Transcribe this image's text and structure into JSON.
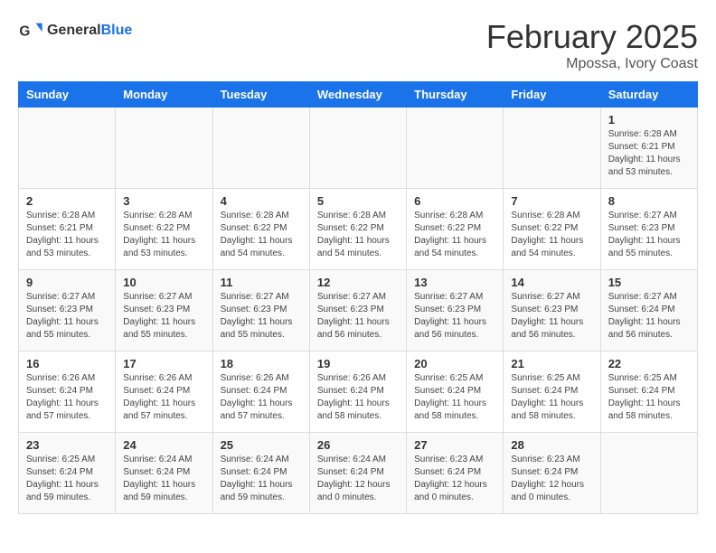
{
  "header": {
    "logo_text_general": "General",
    "logo_text_blue": "Blue",
    "main_title": "February 2025",
    "subtitle": "Mpossa, Ivory Coast"
  },
  "calendar": {
    "days_of_week": [
      "Sunday",
      "Monday",
      "Tuesday",
      "Wednesday",
      "Thursday",
      "Friday",
      "Saturday"
    ],
    "weeks": [
      [
        {
          "day": "",
          "info": ""
        },
        {
          "day": "",
          "info": ""
        },
        {
          "day": "",
          "info": ""
        },
        {
          "day": "",
          "info": ""
        },
        {
          "day": "",
          "info": ""
        },
        {
          "day": "",
          "info": ""
        },
        {
          "day": "1",
          "info": "Sunrise: 6:28 AM\nSunset: 6:21 PM\nDaylight: 11 hours\nand 53 minutes."
        }
      ],
      [
        {
          "day": "2",
          "info": "Sunrise: 6:28 AM\nSunset: 6:21 PM\nDaylight: 11 hours\nand 53 minutes."
        },
        {
          "day": "3",
          "info": "Sunrise: 6:28 AM\nSunset: 6:22 PM\nDaylight: 11 hours\nand 53 minutes."
        },
        {
          "day": "4",
          "info": "Sunrise: 6:28 AM\nSunset: 6:22 PM\nDaylight: 11 hours\nand 54 minutes."
        },
        {
          "day": "5",
          "info": "Sunrise: 6:28 AM\nSunset: 6:22 PM\nDaylight: 11 hours\nand 54 minutes."
        },
        {
          "day": "6",
          "info": "Sunrise: 6:28 AM\nSunset: 6:22 PM\nDaylight: 11 hours\nand 54 minutes."
        },
        {
          "day": "7",
          "info": "Sunrise: 6:28 AM\nSunset: 6:22 PM\nDaylight: 11 hours\nand 54 minutes."
        },
        {
          "day": "8",
          "info": "Sunrise: 6:27 AM\nSunset: 6:23 PM\nDaylight: 11 hours\nand 55 minutes."
        }
      ],
      [
        {
          "day": "9",
          "info": "Sunrise: 6:27 AM\nSunset: 6:23 PM\nDaylight: 11 hours\nand 55 minutes."
        },
        {
          "day": "10",
          "info": "Sunrise: 6:27 AM\nSunset: 6:23 PM\nDaylight: 11 hours\nand 55 minutes."
        },
        {
          "day": "11",
          "info": "Sunrise: 6:27 AM\nSunset: 6:23 PM\nDaylight: 11 hours\nand 55 minutes."
        },
        {
          "day": "12",
          "info": "Sunrise: 6:27 AM\nSunset: 6:23 PM\nDaylight: 11 hours\nand 56 minutes."
        },
        {
          "day": "13",
          "info": "Sunrise: 6:27 AM\nSunset: 6:23 PM\nDaylight: 11 hours\nand 56 minutes."
        },
        {
          "day": "14",
          "info": "Sunrise: 6:27 AM\nSunset: 6:23 PM\nDaylight: 11 hours\nand 56 minutes."
        },
        {
          "day": "15",
          "info": "Sunrise: 6:27 AM\nSunset: 6:24 PM\nDaylight: 11 hours\nand 56 minutes."
        }
      ],
      [
        {
          "day": "16",
          "info": "Sunrise: 6:26 AM\nSunset: 6:24 PM\nDaylight: 11 hours\nand 57 minutes."
        },
        {
          "day": "17",
          "info": "Sunrise: 6:26 AM\nSunset: 6:24 PM\nDaylight: 11 hours\nand 57 minutes."
        },
        {
          "day": "18",
          "info": "Sunrise: 6:26 AM\nSunset: 6:24 PM\nDaylight: 11 hours\nand 57 minutes."
        },
        {
          "day": "19",
          "info": "Sunrise: 6:26 AM\nSunset: 6:24 PM\nDaylight: 11 hours\nand 58 minutes."
        },
        {
          "day": "20",
          "info": "Sunrise: 6:25 AM\nSunset: 6:24 PM\nDaylight: 11 hours\nand 58 minutes."
        },
        {
          "day": "21",
          "info": "Sunrise: 6:25 AM\nSunset: 6:24 PM\nDaylight: 11 hours\nand 58 minutes."
        },
        {
          "day": "22",
          "info": "Sunrise: 6:25 AM\nSunset: 6:24 PM\nDaylight: 11 hours\nand 58 minutes."
        }
      ],
      [
        {
          "day": "23",
          "info": "Sunrise: 6:25 AM\nSunset: 6:24 PM\nDaylight: 11 hours\nand 59 minutes."
        },
        {
          "day": "24",
          "info": "Sunrise: 6:24 AM\nSunset: 6:24 PM\nDaylight: 11 hours\nand 59 minutes."
        },
        {
          "day": "25",
          "info": "Sunrise: 6:24 AM\nSunset: 6:24 PM\nDaylight: 11 hours\nand 59 minutes."
        },
        {
          "day": "26",
          "info": "Sunrise: 6:24 AM\nSunset: 6:24 PM\nDaylight: 12 hours\nand 0 minutes."
        },
        {
          "day": "27",
          "info": "Sunrise: 6:23 AM\nSunset: 6:24 PM\nDaylight: 12 hours\nand 0 minutes."
        },
        {
          "day": "28",
          "info": "Sunrise: 6:23 AM\nSunset: 6:24 PM\nDaylight: 12 hours\nand 0 minutes."
        },
        {
          "day": "",
          "info": ""
        }
      ]
    ]
  }
}
